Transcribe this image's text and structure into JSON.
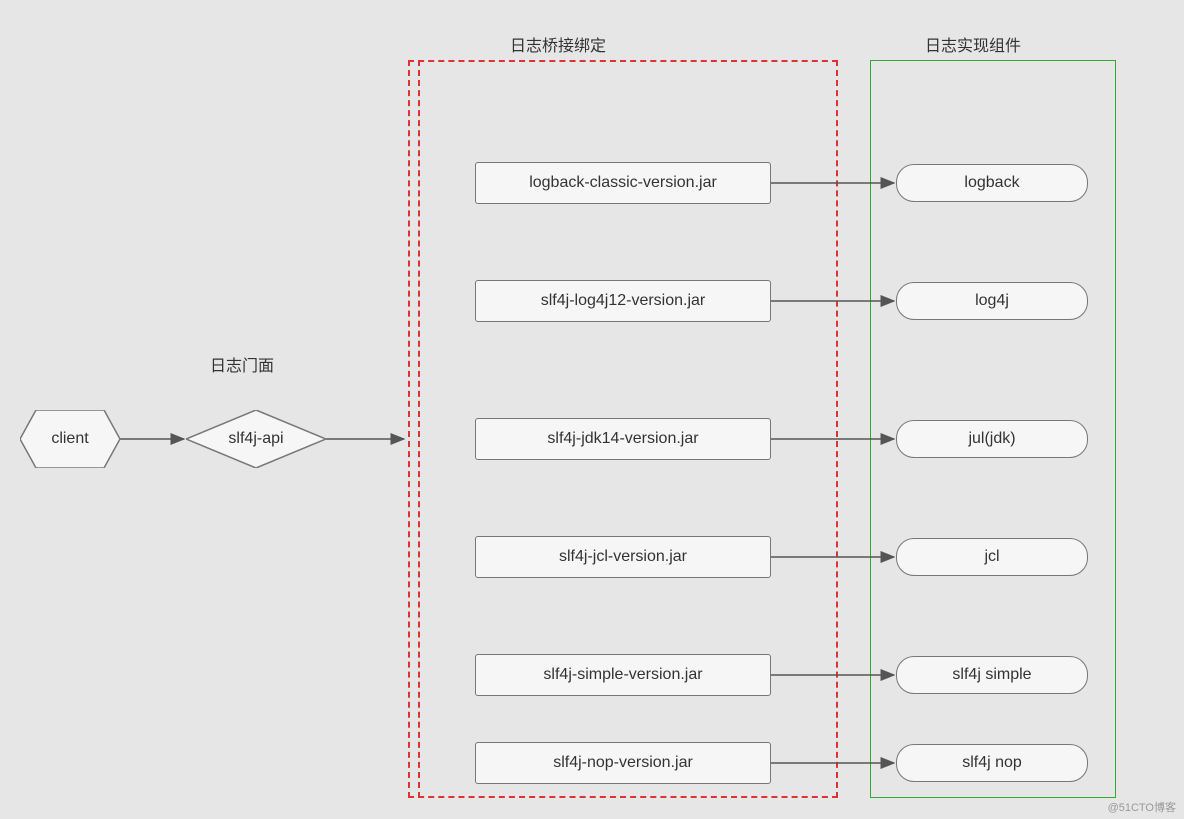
{
  "labels": {
    "facade": "日志门面",
    "bridge": "日志桥接绑定",
    "impl": "日志实现组件"
  },
  "nodes": {
    "client": "client",
    "api": "slf4j-api"
  },
  "bridges": [
    "logback-classic-version.jar",
    "slf4j-log4j12-version.jar",
    "slf4j-jdk14-version.jar",
    "slf4j-jcl-version.jar",
    "slf4j-simple-version.jar",
    "slf4j-nop-version.jar"
  ],
  "impls": [
    "logback",
    "log4j",
    "jul(jdk)",
    "jcl",
    "slf4j simple",
    "slf4j nop"
  ],
  "watermark": "@51CTO博客"
}
